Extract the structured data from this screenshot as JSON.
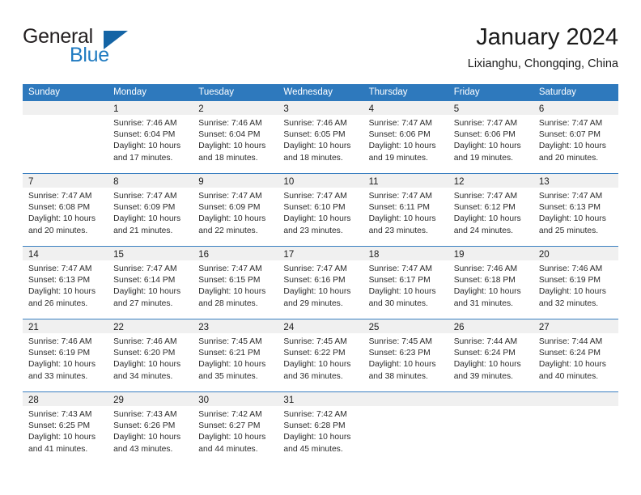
{
  "brand": {
    "name_part1": "General",
    "name_part2": "Blue",
    "accent_color": "#1f7ac0",
    "triangle_color": "#1464a5"
  },
  "header": {
    "title": "January 2024",
    "subtitle": "Lixianghu, Chongqing, China"
  },
  "calendar": {
    "header_bg": "#2e79bd",
    "daynum_bg": "#f0f0f0",
    "weekdays": [
      "Sunday",
      "Monday",
      "Tuesday",
      "Wednesday",
      "Thursday",
      "Friday",
      "Saturday"
    ],
    "weeks": [
      [
        {
          "day": "",
          "empty": true,
          "lines": []
        },
        {
          "day": "1",
          "lines": [
            "Sunrise: 7:46 AM",
            "Sunset: 6:04 PM",
            "Daylight: 10 hours",
            "and 17 minutes."
          ]
        },
        {
          "day": "2",
          "lines": [
            "Sunrise: 7:46 AM",
            "Sunset: 6:04 PM",
            "Daylight: 10 hours",
            "and 18 minutes."
          ]
        },
        {
          "day": "3",
          "lines": [
            "Sunrise: 7:46 AM",
            "Sunset: 6:05 PM",
            "Daylight: 10 hours",
            "and 18 minutes."
          ]
        },
        {
          "day": "4",
          "lines": [
            "Sunrise: 7:47 AM",
            "Sunset: 6:06 PM",
            "Daylight: 10 hours",
            "and 19 minutes."
          ]
        },
        {
          "day": "5",
          "lines": [
            "Sunrise: 7:47 AM",
            "Sunset: 6:06 PM",
            "Daylight: 10 hours",
            "and 19 minutes."
          ]
        },
        {
          "day": "6",
          "lines": [
            "Sunrise: 7:47 AM",
            "Sunset: 6:07 PM",
            "Daylight: 10 hours",
            "and 20 minutes."
          ]
        }
      ],
      [
        {
          "day": "7",
          "lines": [
            "Sunrise: 7:47 AM",
            "Sunset: 6:08 PM",
            "Daylight: 10 hours",
            "and 20 minutes."
          ]
        },
        {
          "day": "8",
          "lines": [
            "Sunrise: 7:47 AM",
            "Sunset: 6:09 PM",
            "Daylight: 10 hours",
            "and 21 minutes."
          ]
        },
        {
          "day": "9",
          "lines": [
            "Sunrise: 7:47 AM",
            "Sunset: 6:09 PM",
            "Daylight: 10 hours",
            "and 22 minutes."
          ]
        },
        {
          "day": "10",
          "lines": [
            "Sunrise: 7:47 AM",
            "Sunset: 6:10 PM",
            "Daylight: 10 hours",
            "and 23 minutes."
          ]
        },
        {
          "day": "11",
          "lines": [
            "Sunrise: 7:47 AM",
            "Sunset: 6:11 PM",
            "Daylight: 10 hours",
            "and 23 minutes."
          ]
        },
        {
          "day": "12",
          "lines": [
            "Sunrise: 7:47 AM",
            "Sunset: 6:12 PM",
            "Daylight: 10 hours",
            "and 24 minutes."
          ]
        },
        {
          "day": "13",
          "lines": [
            "Sunrise: 7:47 AM",
            "Sunset: 6:13 PM",
            "Daylight: 10 hours",
            "and 25 minutes."
          ]
        }
      ],
      [
        {
          "day": "14",
          "lines": [
            "Sunrise: 7:47 AM",
            "Sunset: 6:13 PM",
            "Daylight: 10 hours",
            "and 26 minutes."
          ]
        },
        {
          "day": "15",
          "lines": [
            "Sunrise: 7:47 AM",
            "Sunset: 6:14 PM",
            "Daylight: 10 hours",
            "and 27 minutes."
          ]
        },
        {
          "day": "16",
          "lines": [
            "Sunrise: 7:47 AM",
            "Sunset: 6:15 PM",
            "Daylight: 10 hours",
            "and 28 minutes."
          ]
        },
        {
          "day": "17",
          "lines": [
            "Sunrise: 7:47 AM",
            "Sunset: 6:16 PM",
            "Daylight: 10 hours",
            "and 29 minutes."
          ]
        },
        {
          "day": "18",
          "lines": [
            "Sunrise: 7:47 AM",
            "Sunset: 6:17 PM",
            "Daylight: 10 hours",
            "and 30 minutes."
          ]
        },
        {
          "day": "19",
          "lines": [
            "Sunrise: 7:46 AM",
            "Sunset: 6:18 PM",
            "Daylight: 10 hours",
            "and 31 minutes."
          ]
        },
        {
          "day": "20",
          "lines": [
            "Sunrise: 7:46 AM",
            "Sunset: 6:19 PM",
            "Daylight: 10 hours",
            "and 32 minutes."
          ]
        }
      ],
      [
        {
          "day": "21",
          "lines": [
            "Sunrise: 7:46 AM",
            "Sunset: 6:19 PM",
            "Daylight: 10 hours",
            "and 33 minutes."
          ]
        },
        {
          "day": "22",
          "lines": [
            "Sunrise: 7:46 AM",
            "Sunset: 6:20 PM",
            "Daylight: 10 hours",
            "and 34 minutes."
          ]
        },
        {
          "day": "23",
          "lines": [
            "Sunrise: 7:45 AM",
            "Sunset: 6:21 PM",
            "Daylight: 10 hours",
            "and 35 minutes."
          ]
        },
        {
          "day": "24",
          "lines": [
            "Sunrise: 7:45 AM",
            "Sunset: 6:22 PM",
            "Daylight: 10 hours",
            "and 36 minutes."
          ]
        },
        {
          "day": "25",
          "lines": [
            "Sunrise: 7:45 AM",
            "Sunset: 6:23 PM",
            "Daylight: 10 hours",
            "and 38 minutes."
          ]
        },
        {
          "day": "26",
          "lines": [
            "Sunrise: 7:44 AM",
            "Sunset: 6:24 PM",
            "Daylight: 10 hours",
            "and 39 minutes."
          ]
        },
        {
          "day": "27",
          "lines": [
            "Sunrise: 7:44 AM",
            "Sunset: 6:24 PM",
            "Daylight: 10 hours",
            "and 40 minutes."
          ]
        }
      ],
      [
        {
          "day": "28",
          "lines": [
            "Sunrise: 7:43 AM",
            "Sunset: 6:25 PM",
            "Daylight: 10 hours",
            "and 41 minutes."
          ]
        },
        {
          "day": "29",
          "lines": [
            "Sunrise: 7:43 AM",
            "Sunset: 6:26 PM",
            "Daylight: 10 hours",
            "and 43 minutes."
          ]
        },
        {
          "day": "30",
          "lines": [
            "Sunrise: 7:42 AM",
            "Sunset: 6:27 PM",
            "Daylight: 10 hours",
            "and 44 minutes."
          ]
        },
        {
          "day": "31",
          "lines": [
            "Sunrise: 7:42 AM",
            "Sunset: 6:28 PM",
            "Daylight: 10 hours",
            "and 45 minutes."
          ]
        },
        {
          "day": "",
          "empty": true,
          "lines": []
        },
        {
          "day": "",
          "empty": true,
          "lines": []
        },
        {
          "day": "",
          "empty": true,
          "lines": []
        }
      ]
    ]
  }
}
